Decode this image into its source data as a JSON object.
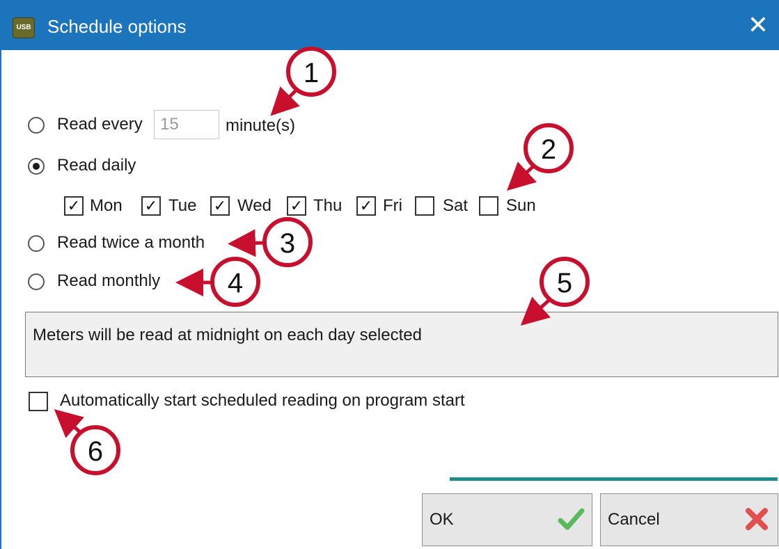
{
  "window": {
    "title": "Schedule options",
    "app_icon_text": "USB",
    "close_glyph": "✕",
    "accent_color": "#1c75bc",
    "close_icon": "close-icon"
  },
  "options": {
    "read_every": {
      "label": "Read every",
      "minutes_value": "15",
      "unit": "minute(s)",
      "selected": false
    },
    "read_daily": {
      "label": "Read daily",
      "selected": true
    },
    "days": [
      {
        "label": "Mon",
        "checked": true
      },
      {
        "label": "Tue",
        "checked": true
      },
      {
        "label": "Wed",
        "checked": true
      },
      {
        "label": "Thu",
        "checked": true
      },
      {
        "label": "Fri",
        "checked": true
      },
      {
        "label": "Sat",
        "checked": false
      },
      {
        "label": "Sun",
        "checked": false
      }
    ],
    "read_twice": {
      "label": "Read twice a month",
      "selected": false
    },
    "read_monthly": {
      "label": "Read monthly",
      "selected": false
    }
  },
  "description": "Meters will be read at midnight on each day selected",
  "auto_start": {
    "label": "Automatically start scheduled reading on program start",
    "checked": false
  },
  "buttons": {
    "ok": {
      "label": "OK",
      "icon": "green-check-icon",
      "icon_color": "#5cb85c"
    },
    "cancel": {
      "label": "Cancel",
      "icon": "red-x-icon",
      "icon_color": "#e05050"
    }
  },
  "annotations": {
    "color": "#c8102e",
    "numbers": [
      "1",
      "2",
      "3",
      "4",
      "5",
      "6"
    ]
  }
}
